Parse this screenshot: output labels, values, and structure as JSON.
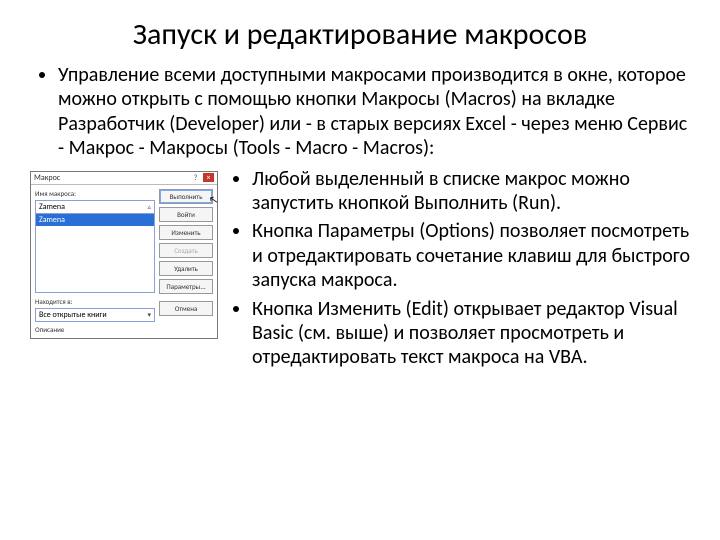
{
  "title": "Запуск и редактирование макросов",
  "intro": "Управление всеми доступными макросами производится в окне, которое можно открыть с помощью кнопки Макросы (Macros) на вкладке Разработчик (Developer) или - в старых версиях Excel - через меню Сервис - Макрос - Макросы (Tools - Macro - Macros):",
  "inner": {
    "b1": "Любой выделенный в списке макрос можно запустить кнопкой Выполнить (Run).",
    "b2": "Кнопка Параметры (Options) позволяет посмотреть и отредактировать сочетание клавиш для быстрого запуска макроса.",
    "b3": "Кнопка Изменить (Edit) открывает редактор Visual Basic (см. выше) и позволяет просмотреть и отредактировать текст макроса на VBA."
  },
  "dlg": {
    "title": "Макрос",
    "label_name": "Имя макроса:",
    "name_value": "Zamena",
    "list_selected": "Zamena",
    "label_in": "Находится в:",
    "in_value": "Все открытые книги",
    "label_desc": "Описание",
    "buttons": {
      "run": "Выполнить",
      "step": "Войти",
      "edit": "Изменить",
      "create": "Создать",
      "delete": "Удалить",
      "options": "Параметры...",
      "cancel": "Отмена"
    }
  }
}
